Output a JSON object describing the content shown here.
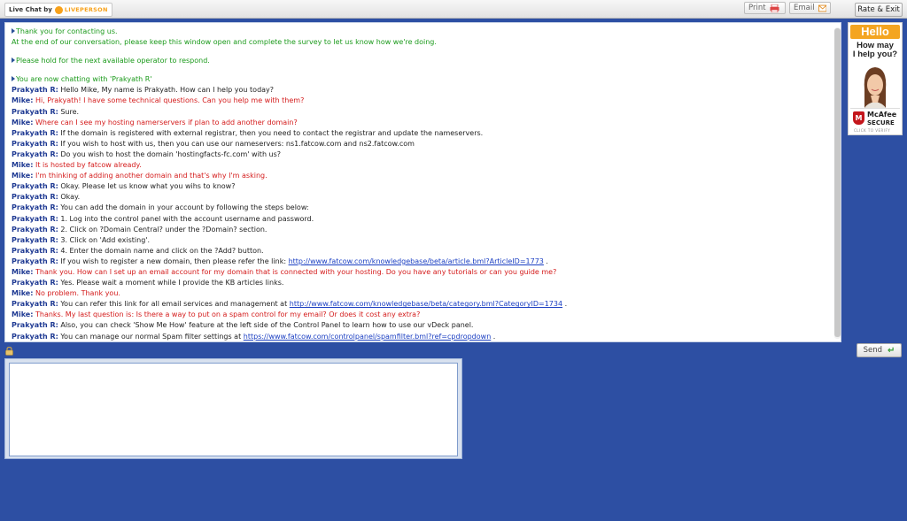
{
  "brand": {
    "label": "Live Chat by",
    "company": "LIVEPERSON"
  },
  "toolbar": {
    "print_label": "Print",
    "email_label": "Email",
    "rate_exit_label": "Rate & Exit"
  },
  "system_messages": [
    {
      "lines": [
        "Thank you for contacting us.",
        "At the end of our conversation, please keep this window open and complete the survey to let us know how we're doing."
      ]
    },
    {
      "lines": [
        "Please hold for the next available operator to respond."
      ]
    },
    {
      "lines": [
        "You are now chatting with 'Prakyath R'"
      ]
    }
  ],
  "messages": [
    {
      "sender": "Prakyath R:",
      "role": "operator",
      "text": " Hello Mike, My name is Prakyath. How can I help you today?"
    },
    {
      "sender": "Mike:",
      "role": "visitor",
      "text": " Hi, Prakyath! I have some technical questions. Can you help me with them?"
    },
    {
      "sender": "Prakyath R:",
      "role": "operator",
      "text": " Sure."
    },
    {
      "sender": "Mike:",
      "role": "visitor",
      "text": " Where can I see my hosting namerservers if plan to add another domain?"
    },
    {
      "sender": "Prakyath R:",
      "role": "operator",
      "text": " If the domain is registered with external registrar, then you need to contact the registrar and update the nameservers."
    },
    {
      "sender": "Prakyath R:",
      "role": "operator",
      "text": " If you wish to host with us, then you can use our nameservers: ns1.fatcow.com and ns2.fatcow.com"
    },
    {
      "sender": "Prakyath R:",
      "role": "operator",
      "text": " Do you wish to host the domain 'hostingfacts-fc.com' with us?"
    },
    {
      "sender": "Mike:",
      "role": "visitor",
      "text": " It is hosted by fatcow already."
    },
    {
      "sender": "Mike:",
      "role": "visitor",
      "text": " I'm thinking of adding another domain and that's why I'm asking."
    },
    {
      "sender": "Prakyath R:",
      "role": "operator",
      "text": " Okay. Please let us know what you wihs to know?"
    },
    {
      "sender": "Prakyath R:",
      "role": "operator",
      "text": " Okay."
    },
    {
      "sender": "Prakyath R:",
      "role": "operator",
      "text": " You can add the domain in your account by following the steps below:"
    },
    {
      "sender": "Prakyath R:",
      "role": "operator",
      "text": " 1. Log into the control panel with the account username and password."
    },
    {
      "sender": "Prakyath R:",
      "role": "operator",
      "text": " 2. Click on ?Domain Central? under the ?Domain? section."
    },
    {
      "sender": "Prakyath R:",
      "role": "operator",
      "text": " 3. Click on 'Add existing'."
    },
    {
      "sender": "Prakyath R:",
      "role": "operator",
      "text": " 4. Enter the domain name and click on the ?Add? button."
    },
    {
      "sender": "Prakyath R:",
      "role": "operator",
      "text": " If you wish to register a new domain, then please refer the link: ",
      "link": "http://www.fatcow.com/knowledgebase/beta/article.bml?ArticleID=1773",
      "after": " ."
    },
    {
      "sender": "Mike:",
      "role": "visitor",
      "text": " Thank you. How can I set up an email account for my domain that is connected with your hosting. Do you have any tutorials or can you guide me?"
    },
    {
      "sender": "Prakyath R:",
      "role": "operator",
      "text": " Yes. Please wait a moment while I provide the KB articles links."
    },
    {
      "sender": "Mike:",
      "role": "visitor",
      "text": " No problem. Thank you."
    },
    {
      "sender": "Prakyath R:",
      "role": "operator",
      "text": " You can refer this link for all email services and management at ",
      "link": "http://www.fatcow.com/knowledgebase/beta/category.bml?CategoryID=1734",
      "after": " ."
    },
    {
      "sender": "Mike:",
      "role": "visitor",
      "text": " Thanks. My last question is: Is there a way to put on a spam control for my email? Or does it cost any extra?"
    },
    {
      "sender": "Prakyath R:",
      "role": "operator",
      "text": " Also, you can check 'Show Me How' feature at the left side of the Control Panel to learn how to use our vDeck panel."
    },
    {
      "sender": "Prakyath R:",
      "role": "operator",
      "text": " You can manage our normal Spam filter settings at ",
      "link": "https://www.fatcow.com/controlpanel/spamfilter.bml?ref=cpdropdown",
      "after": " ."
    }
  ],
  "ad": {
    "hello": "Hello",
    "help_line1": "How may",
    "help_line2": "I help you?",
    "mcafee_name": "McAfee",
    "mcafee_secure": "SECURE",
    "mcafee_verify": "CLICK TO VERIFY"
  },
  "input": {
    "value": "",
    "placeholder": ""
  },
  "send_label": "Send",
  "colors": {
    "background": "#2d4fa3",
    "system_text": "#1b9a1b",
    "visitor_text": "#d41b1b",
    "sender_name": "#1f3a93",
    "link": "#1a3ec2",
    "accent": "#f4a521"
  }
}
